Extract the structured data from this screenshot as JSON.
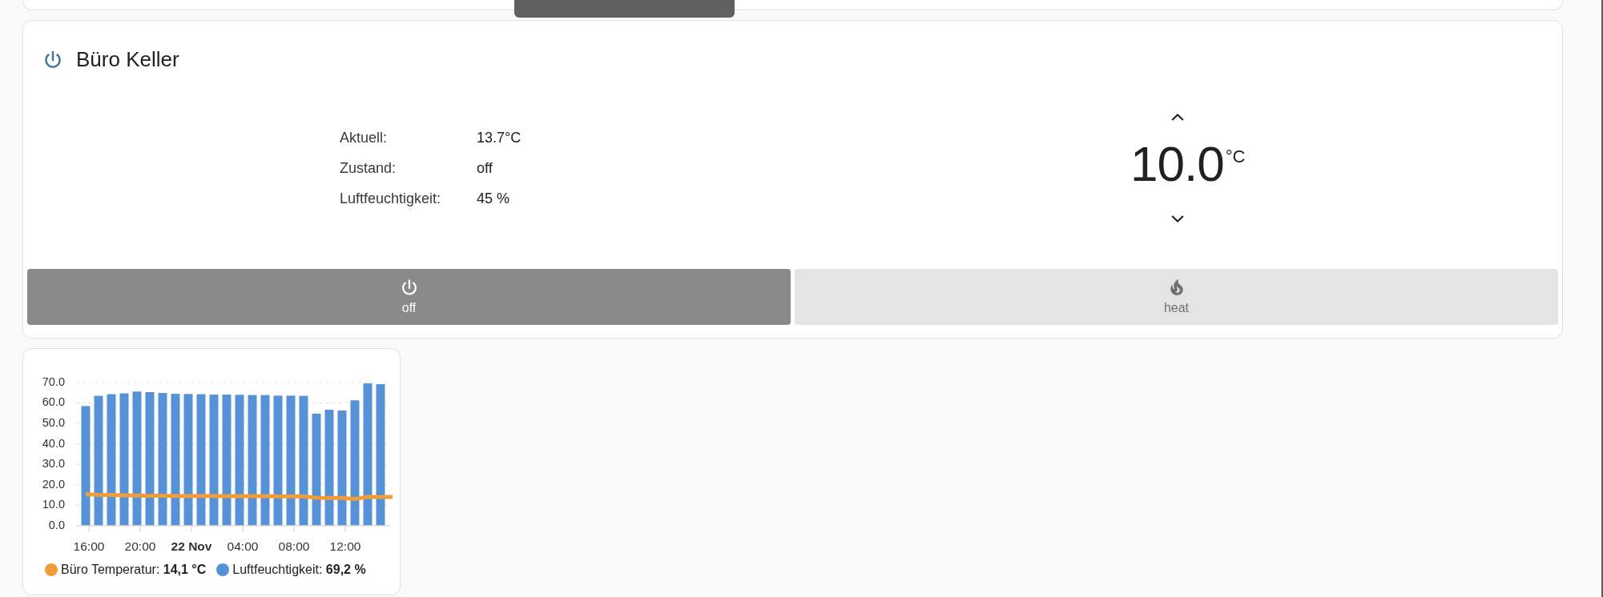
{
  "thermostat_card": {
    "title": "Büro Keller",
    "attributes": [
      {
        "label": "Aktuell:",
        "value": "13.7°C"
      },
      {
        "label": "Zustand:",
        "value": "off"
      },
      {
        "label": "Luftfeuchtigkeit:",
        "value": "45 %"
      }
    ],
    "target": {
      "value": "10.0",
      "unit": "°C"
    },
    "modes": [
      {
        "kind": "power",
        "label": "off",
        "selected": true
      },
      {
        "kind": "flame",
        "label": "heat",
        "selected": false
      }
    ]
  },
  "history_card": {
    "chart_data": {
      "type": "bar",
      "grid": true,
      "ylim": [
        0,
        70
      ],
      "categories": [
        "16:00",
        null,
        null,
        null,
        "20:00",
        null,
        null,
        null,
        "**22 Nov**",
        null,
        null,
        null,
        "04:00",
        null,
        null,
        null,
        "08:00",
        null,
        null,
        null,
        "12:00",
        null,
        null,
        null
      ],
      "yticks": [
        {
          "value": 0,
          "label": "0.0"
        },
        {
          "value": 10,
          "label": "10.0"
        },
        {
          "value": 20,
          "label": "20.0"
        },
        {
          "value": 30,
          "label": "30.0"
        },
        {
          "value": 40,
          "label": "40.0"
        },
        {
          "value": 50,
          "label": "50.0"
        },
        {
          "value": 60,
          "label": "60.0"
        },
        {
          "value": 70,
          "label": "70.0"
        }
      ],
      "series": [
        {
          "name": "Büro Temperatur",
          "type": "line",
          "color": "#ef9d3a",
          "values": [
            15.4,
            15.1,
            15.0,
            14.9,
            14.8,
            14.7,
            14.7,
            14.6,
            14.6,
            14.6,
            14.6,
            14.5,
            14.5,
            14.5,
            14.5,
            14.4,
            14.4,
            14.4,
            13.7,
            13.6,
            13.6,
            13.1,
            14.1,
            14.1
          ]
        },
        {
          "name": "Luftfeuchtigkeit",
          "type": "bar",
          "color": "#5593d6",
          "values": [
            58.5,
            63.5,
            64.3,
            64.7,
            65.6,
            65.3,
            64.9,
            64.5,
            64.4,
            64.3,
            64.1,
            64.1,
            64.0,
            63.9,
            63.9,
            63.6,
            63.6,
            63.5,
            54.8,
            56.7,
            56.3,
            61.3,
            69.6,
            69.2
          ]
        }
      ]
    },
    "legend": [
      {
        "text": ": **14,1 °C**"
      },
      {
        "text": ": **69,2 %**"
      }
    ]
  }
}
